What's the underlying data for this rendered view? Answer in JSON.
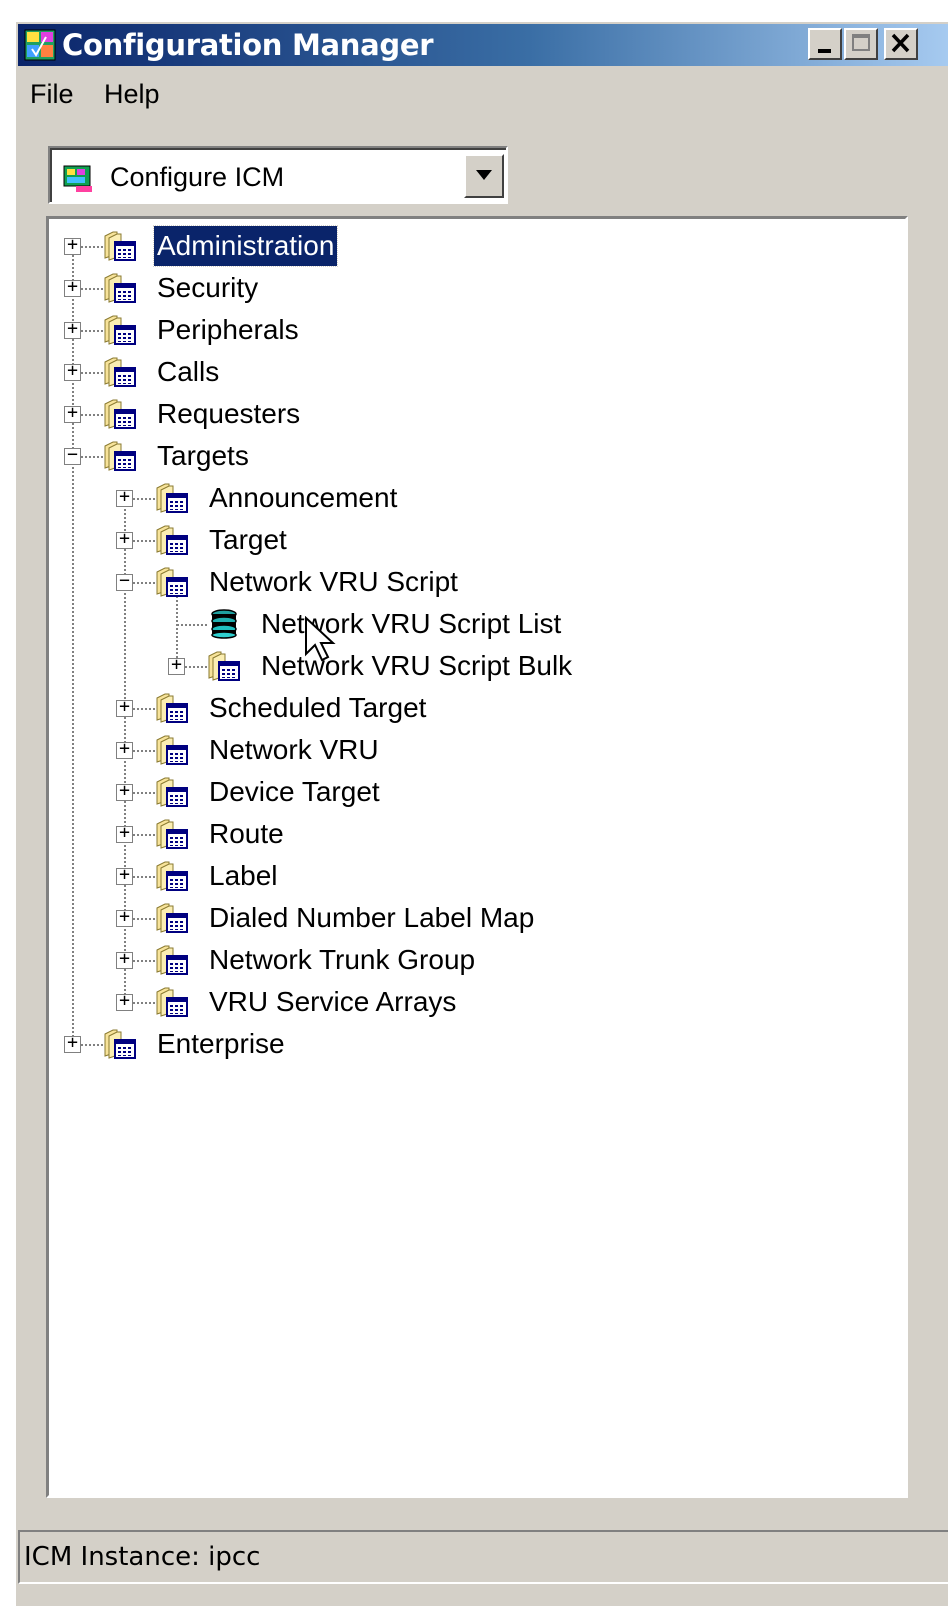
{
  "window": {
    "title": "Configuration Manager"
  },
  "menu": {
    "file": "File",
    "help": "Help"
  },
  "combo": {
    "value": "Configure ICM"
  },
  "tree": {
    "administration": "Administration",
    "security": "Security",
    "peripherals": "Peripherals",
    "calls": "Calls",
    "requesters": "Requesters",
    "targets": "Targets",
    "announcement": "Announcement",
    "target": "Target",
    "network_vru_script": "Network VRU Script",
    "network_vru_script_list": "Network VRU Script List",
    "network_vru_script_bulk": "Network VRU Script Bulk",
    "scheduled_target": "Scheduled Target",
    "network_vru": "Network VRU",
    "device_target": "Device Target",
    "route": "Route",
    "label": "Label",
    "dialed_number_label_map": "Dialed Number Label Map",
    "network_trunk_group": "Network Trunk Group",
    "vru_service_arrays": "VRU Service Arrays",
    "enterprise": "Enterprise"
  },
  "status": {
    "text": "ICM Instance: ipcc"
  },
  "colors": {
    "selection": "#0a246a",
    "title_start": "#0a246a",
    "title_end": "#a6caf0",
    "face": "#d4d0c8"
  }
}
